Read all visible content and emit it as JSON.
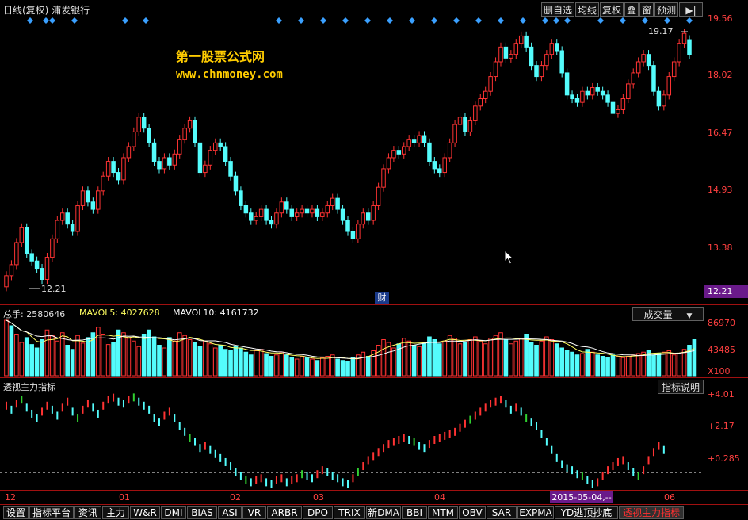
{
  "header": {
    "title": "日线(复权) 浦发银行",
    "buttons": [
      "删自选",
      "均线",
      "复权",
      "叠",
      "窗",
      "预测"
    ],
    "arrow_label": "▶|"
  },
  "watermark": {
    "line1": "第一股票公式网",
    "line2": "www.chnmoney.com"
  },
  "price_panel": {
    "axis_labels": [
      "19.56",
      "18.02",
      "16.47",
      "14.93",
      "13.38",
      "12.21"
    ],
    "high_label": "19.17",
    "low_label": "12.21",
    "cai_marker": "财"
  },
  "volume_panel": {
    "total": "总手: 2580646",
    "mavol5": "MAVOL5: 4027628",
    "mavol10": "MAVOL10: 4161732",
    "dropdown": "成交量",
    "axis_labels": [
      "86970",
      "43485",
      "X100"
    ]
  },
  "indicator_panel": {
    "title": "透视主力指标",
    "help_button": "指标说明",
    "axis_labels": [
      "+4.01",
      "+2.17",
      "+0.285"
    ]
  },
  "x_axis": {
    "month_labels": [
      "12",
      "01",
      "02",
      "03",
      "04",
      "06"
    ],
    "cursor_date": "2015-05-04,--"
  },
  "tabs": [
    "设置",
    "指标平台",
    "资讯",
    "主力",
    "W&R",
    "DMI",
    "BIAS",
    "ASI",
    "VR",
    "ARBR",
    "DPO",
    "TRIX",
    "新DMA",
    "BBI",
    "MTM",
    "OBV",
    "SAR",
    "EXPMA",
    "YD逃顶抄底",
    "透视主力指标"
  ],
  "colors": {
    "up": "#ff3333",
    "down": "#54fcfc",
    "frame": "#a01010",
    "watermark": "#ffcc00"
  },
  "chart_data": [
    {
      "type": "candlestick",
      "title": "日线(复权) 浦发银行",
      "ylim": [
        12.21,
        19.56
      ],
      "yticks": [
        19.56,
        18.02,
        16.47,
        14.93,
        13.38,
        12.21
      ],
      "x_month_labels": [
        "12",
        "01",
        "02",
        "03",
        "04",
        "06"
      ],
      "high_marked": 19.17,
      "low_marked": 12.21,
      "close": [
        12.6,
        12.9,
        13.5,
        13.9,
        13.2,
        13.0,
        12.8,
        12.5,
        13.1,
        13.6,
        14.1,
        14.3,
        14.0,
        13.8,
        14.5,
        14.9,
        14.6,
        14.4,
        14.9,
        15.3,
        15.7,
        15.4,
        15.2,
        15.8,
        16.1,
        16.5,
        16.9,
        16.6,
        16.2,
        15.7,
        15.5,
        15.8,
        15.6,
        15.9,
        16.3,
        16.6,
        16.8,
        16.2,
        15.4,
        15.6,
        16.0,
        16.2,
        16.1,
        15.7,
        15.3,
        14.9,
        14.5,
        14.3,
        14.1,
        14.2,
        14.4,
        14.1,
        14.0,
        14.3,
        14.6,
        14.4,
        14.2,
        14.3,
        14.4,
        14.3,
        14.4,
        14.2,
        14.3,
        14.5,
        14.7,
        14.4,
        14.1,
        13.8,
        13.6,
        14.0,
        14.3,
        14.1,
        14.5,
        15.0,
        15.5,
        15.8,
        16.0,
        15.9,
        16.1,
        16.3,
        16.2,
        16.4,
        16.2,
        15.7,
        15.5,
        15.4,
        15.8,
        16.2,
        16.7,
        16.9,
        16.5,
        16.8,
        17.2,
        17.4,
        17.6,
        18.0,
        18.4,
        18.8,
        18.5,
        18.6,
        18.9,
        19.1,
        18.8,
        18.3,
        18.0,
        18.3,
        18.6,
        18.9,
        18.7,
        18.1,
        17.5,
        17.4,
        17.3,
        17.6,
        17.5,
        17.7,
        17.6,
        17.5,
        17.3,
        17.0,
        17.1,
        17.4,
        17.8,
        18.1,
        18.4,
        18.6,
        18.3,
        17.6,
        17.2,
        17.5,
        18.0,
        18.4,
        18.9,
        19.17,
        18.6
      ],
      "open": [
        12.3,
        12.6,
        12.9,
        13.5,
        13.9,
        13.2,
        13.0,
        12.8,
        12.5,
        13.1,
        13.6,
        14.1,
        14.3,
        14.0,
        13.8,
        14.5,
        14.9,
        14.6,
        14.4,
        14.9,
        15.3,
        15.7,
        15.4,
        15.2,
        15.8,
        16.1,
        16.5,
        16.9,
        16.6,
        16.2,
        15.7,
        15.5,
        15.8,
        15.6,
        15.9,
        16.3,
        16.6,
        16.8,
        16.2,
        15.4,
        15.6,
        16.0,
        16.2,
        16.1,
        15.7,
        15.3,
        14.9,
        14.5,
        14.3,
        14.1,
        14.2,
        14.4,
        14.1,
        14.0,
        14.3,
        14.6,
        14.4,
        14.2,
        14.3,
        14.4,
        14.3,
        14.4,
        14.2,
        14.3,
        14.5,
        14.7,
        14.4,
        14.1,
        13.8,
        13.6,
        14.0,
        14.3,
        14.1,
        14.5,
        15.0,
        15.5,
        15.8,
        16.0,
        15.9,
        16.1,
        16.3,
        16.2,
        16.4,
        16.2,
        15.7,
        15.5,
        15.4,
        15.8,
        16.2,
        16.7,
        16.9,
        16.5,
        16.8,
        17.2,
        17.4,
        17.6,
        18.0,
        18.4,
        18.8,
        18.5,
        18.6,
        18.9,
        19.1,
        18.8,
        18.3,
        18.0,
        18.3,
        18.6,
        18.9,
        18.7,
        18.1,
        17.5,
        17.4,
        17.3,
        17.6,
        17.5,
        17.7,
        17.6,
        17.5,
        17.3,
        17.0,
        17.1,
        17.4,
        17.8,
        18.1,
        18.4,
        18.6,
        18.3,
        17.6,
        17.2,
        17.5,
        18.0,
        18.4,
        18.9,
        19.0
      ]
    },
    {
      "type": "bar",
      "title": "成交量",
      "ylim": [
        0,
        86970
      ],
      "yticks": [
        86970,
        43485
      ],
      "unit": "X100",
      "values": [
        80,
        72,
        60,
        48,
        55,
        45,
        40,
        52,
        66,
        58,
        50,
        62,
        44,
        38,
        58,
        47,
        55,
        62,
        70,
        60,
        45,
        48,
        66,
        62,
        54,
        50,
        42,
        60,
        66,
        56,
        44,
        40,
        55,
        50,
        62,
        58,
        52,
        48,
        42,
        50,
        46,
        40,
        44,
        38,
        36,
        42,
        40,
        34,
        30,
        36,
        38,
        32,
        28,
        30,
        34,
        30,
        26,
        24,
        28,
        26,
        24,
        22,
        26,
        28,
        30,
        24,
        22,
        20,
        26,
        30,
        34,
        28,
        36,
        44,
        52,
        48,
        40,
        46,
        54,
        50,
        44,
        42,
        48,
        56,
        52,
        46,
        50,
        58,
        54,
        46,
        48,
        52,
        56,
        50,
        46,
        54,
        58,
        62,
        52,
        46,
        50,
        54,
        60,
        48,
        44,
        50,
        56,
        52,
        46,
        40,
        36,
        34,
        30,
        32,
        38,
        34,
        30,
        28,
        26,
        30,
        28,
        26,
        28,
        30,
        32,
        34,
        36,
        30,
        32,
        34,
        36,
        30,
        32,
        38,
        44,
        52
      ],
      "up_flags": [
        1,
        0,
        1,
        1,
        0,
        0,
        0,
        0,
        1,
        1,
        1,
        1,
        0,
        0,
        1,
        1,
        0,
        0,
        1,
        1,
        1,
        0,
        0,
        1,
        1,
        1,
        1,
        0,
        0,
        0,
        0,
        1,
        0,
        1,
        1,
        1,
        1,
        0,
        0,
        1,
        1,
        1,
        0,
        0,
        0,
        0,
        0,
        0,
        0,
        1,
        1,
        0,
        0,
        1,
        1,
        0,
        0,
        1,
        1,
        0,
        1,
        0,
        1,
        1,
        1,
        0,
        0,
        0,
        0,
        1,
        1,
        0,
        1,
        1,
        1,
        1,
        1,
        0,
        1,
        1,
        0,
        1,
        0,
        0,
        0,
        0,
        1,
        1,
        1,
        1,
        0,
        1,
        1,
        1,
        1,
        1,
        1,
        1,
        0,
        1,
        1,
        1,
        0,
        0,
        0,
        1,
        1,
        1,
        0,
        0,
        0,
        0,
        0,
        1,
        0,
        1,
        0,
        0,
        0,
        0,
        1,
        1,
        1,
        1,
        1,
        1,
        0,
        0,
        0,
        1,
        1,
        1,
        1,
        1,
        0
      ]
    },
    {
      "type": "scatter",
      "title": "透视主力指标",
      "ylim": [
        -0.5,
        4.3
      ],
      "yticks": [
        4.01,
        2.17,
        0.285
      ],
      "reference_line": 0.285,
      "values": [
        3.6,
        3.4,
        3.7,
        3.9,
        3.5,
        3.2,
        3.0,
        3.3,
        3.6,
        3.4,
        3.1,
        3.5,
        3.8,
        3.3,
        3.0,
        3.4,
        3.7,
        3.5,
        3.2,
        3.6,
        3.9,
        4.0,
        3.8,
        3.7,
        3.9,
        4.01,
        3.8,
        3.6,
        3.4,
        3.0,
        2.8,
        3.1,
        3.3,
        3.0,
        2.6,
        2.3,
        2.0,
        1.8,
        1.5,
        1.6,
        1.4,
        1.2,
        1.0,
        0.8,
        0.6,
        0.3,
        0.1,
        -0.1,
        -0.2,
        -0.1,
        0.0,
        -0.2,
        -0.3,
        -0.1,
        0.0,
        -0.2,
        -0.1,
        0.0,
        0.2,
        0.1,
        0.0,
        0.2,
        0.4,
        0.3,
        0.1,
        0.0,
        -0.2,
        -0.3,
        0.0,
        0.3,
        0.6,
        0.9,
        1.1,
        1.3,
        1.5,
        1.7,
        1.8,
        1.9,
        2.0,
        1.9,
        1.8,
        1.6,
        1.5,
        1.7,
        1.9,
        2.0,
        2.1,
        2.2,
        2.3,
        2.5,
        2.7,
        2.9,
        3.1,
        3.3,
        3.5,
        3.7,
        3.8,
        3.9,
        3.7,
        3.4,
        3.5,
        3.3,
        3.0,
        2.8,
        2.6,
        2.2,
        1.8,
        1.4,
        1.0,
        0.7,
        0.5,
        0.4,
        0.2,
        0.1,
        -0.1,
        -0.3,
        -0.2,
        0.1,
        0.4,
        0.6,
        0.8,
        0.9,
        0.6,
        0.3,
        0.1,
        0.4,
        0.9,
        1.3,
        1.6,
        1.4
      ],
      "up_flags": [
        1,
        0,
        1,
        1,
        0,
        0,
        0,
        1,
        1,
        0,
        0,
        1,
        1,
        0,
        0,
        1,
        1,
        0,
        0,
        1,
        1,
        1,
        0,
        0,
        1,
        1,
        0,
        0,
        0,
        0,
        0,
        1,
        1,
        0,
        0,
        0,
        0,
        0,
        0,
        1,
        0,
        0,
        0,
        0,
        0,
        0,
        0,
        0,
        0,
        1,
        1,
        0,
        0,
        1,
        1,
        0,
        1,
        1,
        1,
        0,
        0,
        1,
        1,
        0,
        0,
        0,
        0,
        0,
        1,
        1,
        1,
        1,
        1,
        1,
        1,
        1,
        1,
        1,
        1,
        0,
        0,
        0,
        0,
        1,
        1,
        1,
        1,
        1,
        1,
        1,
        1,
        1,
        1,
        1,
        1,
        1,
        1,
        1,
        0,
        0,
        1,
        0,
        0,
        0,
        0,
        0,
        0,
        0,
        0,
        0,
        0,
        0,
        0,
        0,
        0,
        0,
        1,
        1,
        1,
        1,
        1,
        1,
        0,
        0,
        0,
        1,
        1,
        1,
        1,
        0
      ]
    }
  ]
}
